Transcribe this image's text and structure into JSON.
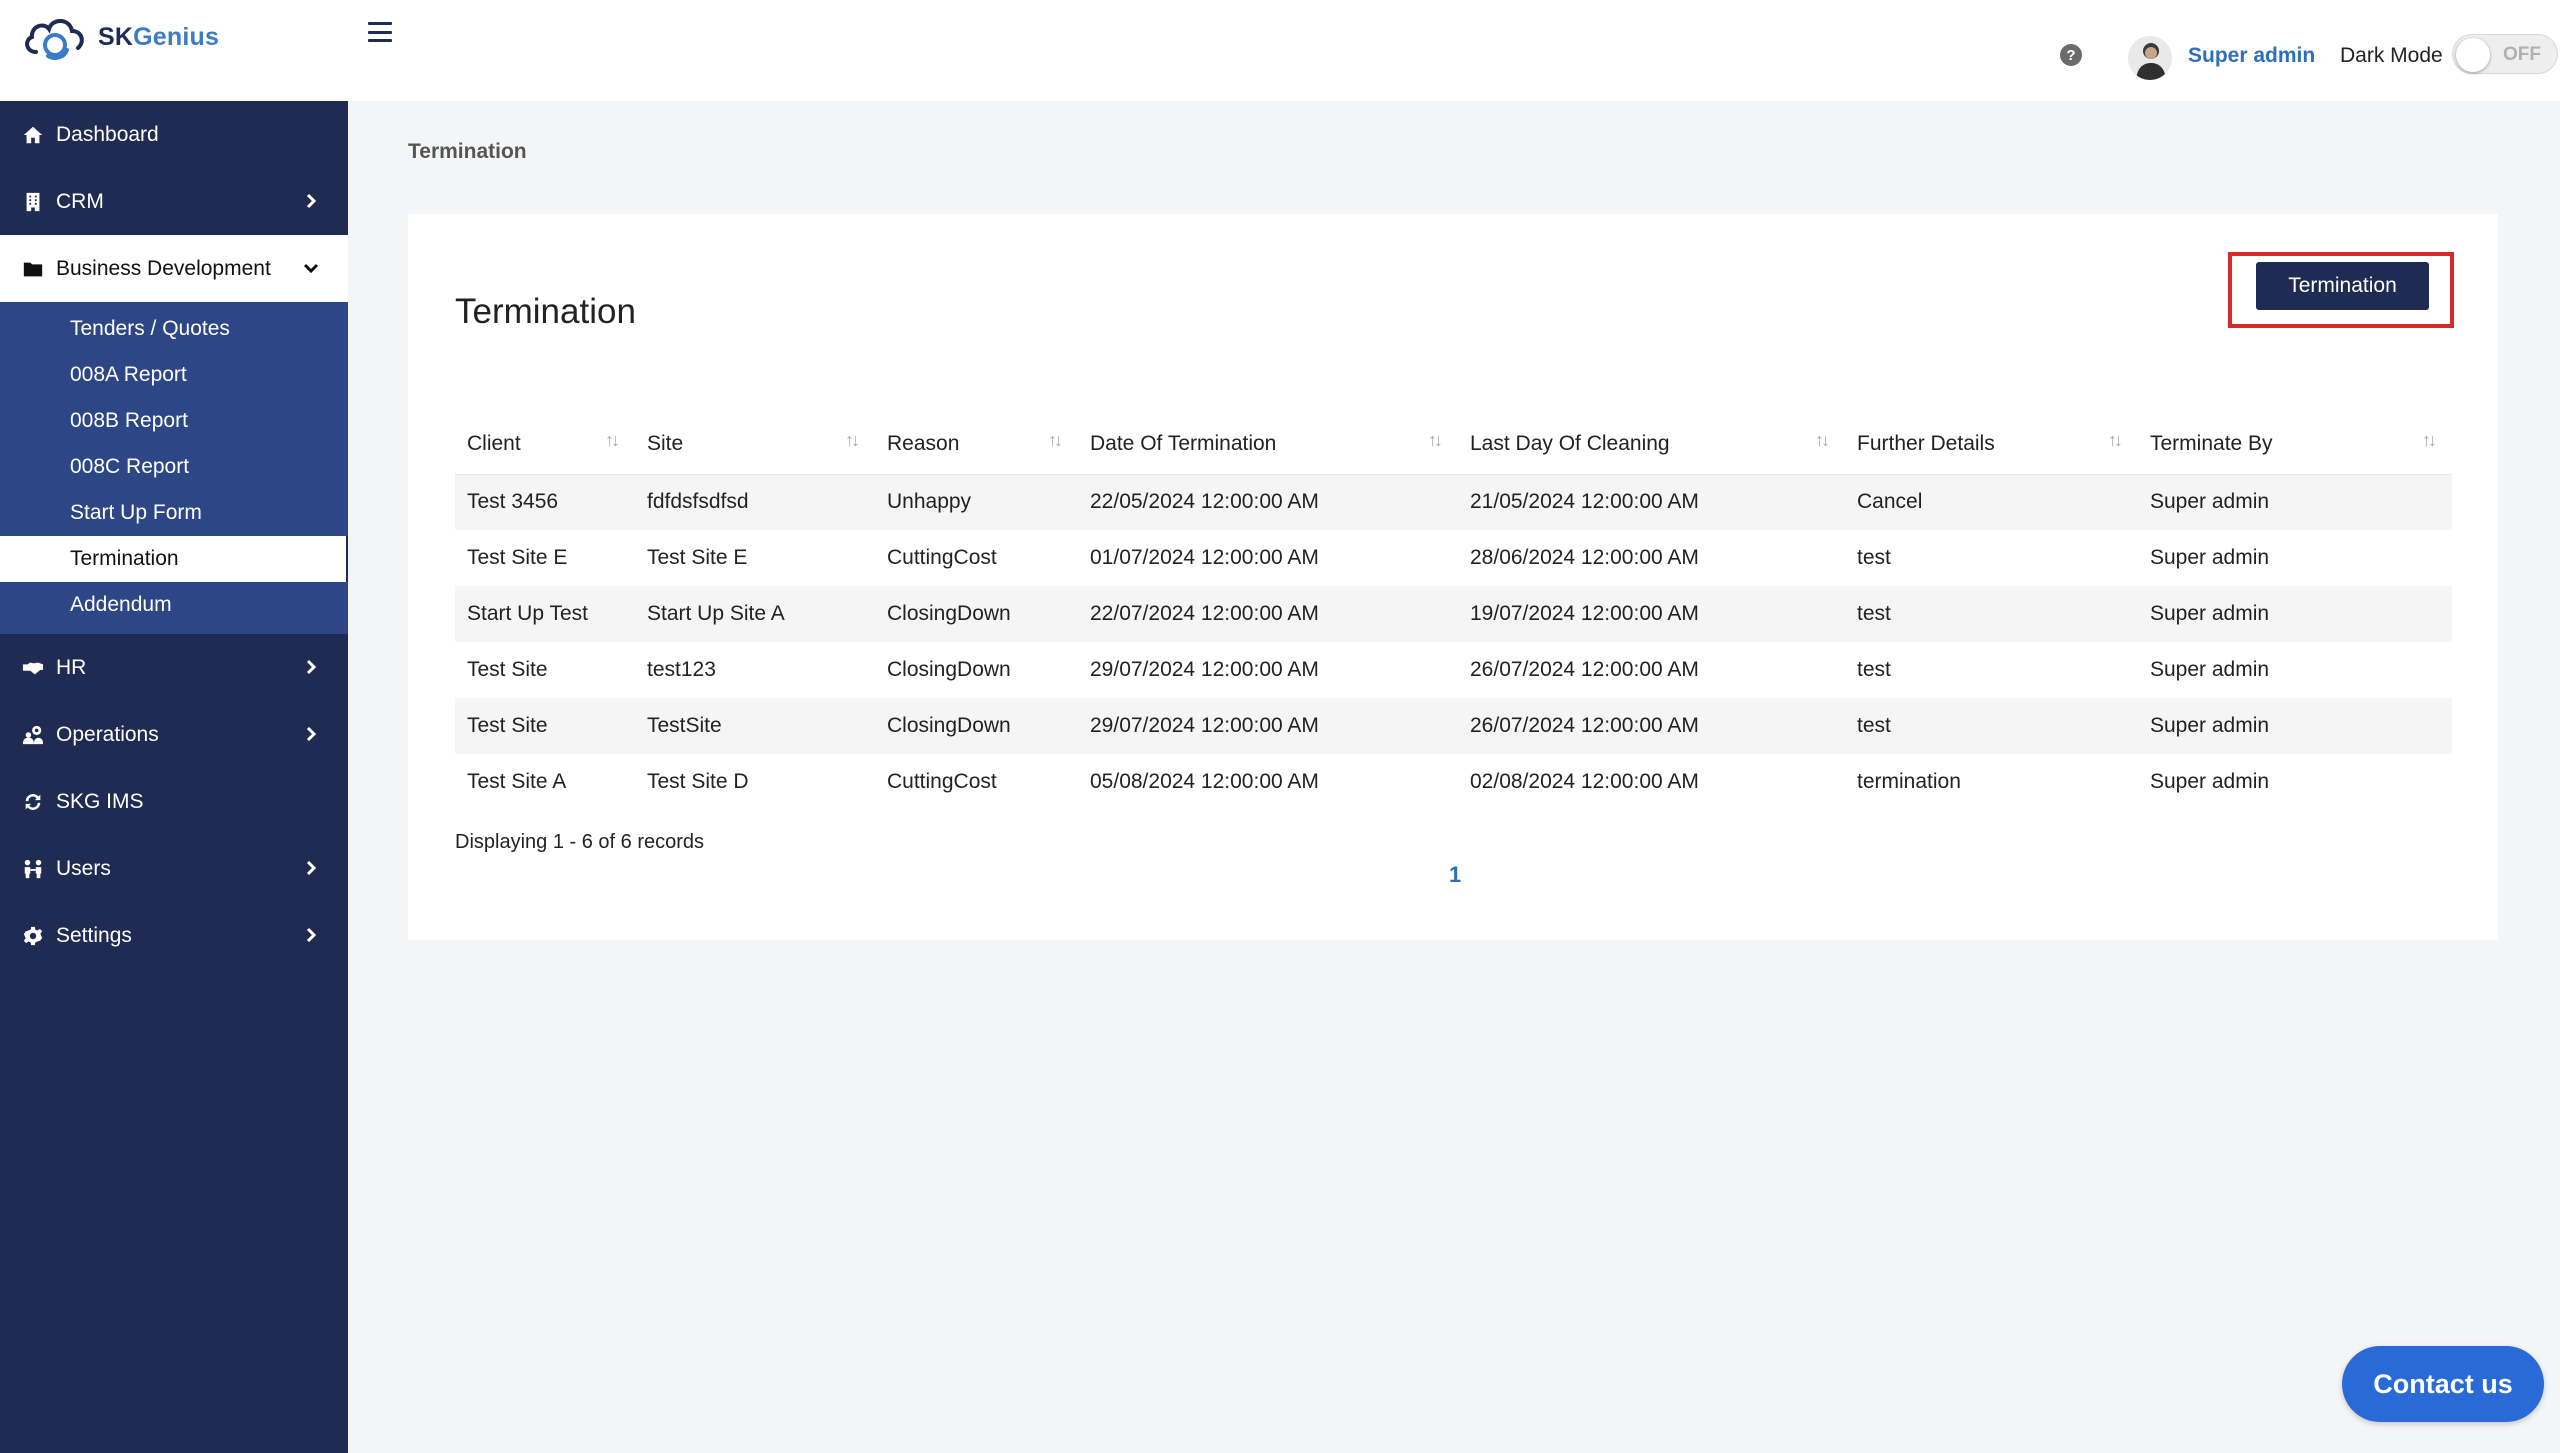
{
  "brand": {
    "name_part1": "SK",
    "name_part2": "Genius"
  },
  "header": {
    "user_name": "Super admin",
    "dark_mode_label": "Dark Mode",
    "dark_mode_state": "OFF",
    "help_icon": "?"
  },
  "sidebar": {
    "items": [
      {
        "label": "Dashboard",
        "icon": "home-icon"
      },
      {
        "label": "CRM",
        "icon": "building-icon"
      },
      {
        "label": "Business Development",
        "icon": "folder-icon"
      },
      {
        "label": "HR",
        "icon": "handshake-icon"
      },
      {
        "label": "Operations",
        "icon": "gear-users-icon"
      },
      {
        "label": "SKG IMS",
        "icon": "sync-icon"
      },
      {
        "label": "Users",
        "icon": "users-icon"
      },
      {
        "label": "Settings",
        "icon": "gear-icon"
      }
    ],
    "submenu": [
      "Tenders / Quotes",
      "008A Report",
      "008B Report",
      "008C Report",
      "Start Up Form",
      "Termination",
      "Addendum"
    ]
  },
  "breadcrumb": "Termination",
  "card": {
    "title": "Termination",
    "button_label": "Termination",
    "table": {
      "columns": [
        "Client",
        "Site",
        "Reason",
        "Date Of Termination",
        "Last Day Of Cleaning",
        "Further Details",
        "Terminate By"
      ],
      "rows": [
        [
          "Test 3456",
          "fdfdsfsdfsd",
          "Unhappy",
          "22/05/2024 12:00:00 AM",
          "21/05/2024 12:00:00 AM",
          "Cancel",
          "Super admin"
        ],
        [
          "Test Site E",
          "Test Site E",
          "CuttingCost",
          "01/07/2024 12:00:00 AM",
          "28/06/2024 12:00:00 AM",
          "test",
          "Super admin"
        ],
        [
          "Start Up Test",
          "Start Up Site A",
          "ClosingDown",
          "22/07/2024 12:00:00 AM",
          "19/07/2024 12:00:00 AM",
          "test",
          "Super admin"
        ],
        [
          "Test Site",
          "test123",
          "ClosingDown",
          "29/07/2024 12:00:00 AM",
          "26/07/2024 12:00:00 AM",
          "test",
          "Super admin"
        ],
        [
          "Test Site",
          "TestSite",
          "ClosingDown",
          "29/07/2024 12:00:00 AM",
          "26/07/2024 12:00:00 AM",
          "test",
          "Super admin"
        ],
        [
          "Test Site A",
          "Test Site D",
          "CuttingCost",
          "05/08/2024 12:00:00 AM",
          "02/08/2024 12:00:00 AM",
          "termination",
          "Super admin"
        ]
      ]
    },
    "records_text": "Displaying 1 - 6 of 6 records",
    "current_page": "1"
  },
  "contact_label": "Contact us",
  "colors": {
    "sidebar_bg": "#1f2b52",
    "submenu_bg": "#2d4786",
    "accent_blue": "#2d6fb8",
    "highlight_red": "#d52b2b",
    "contact_bg": "#2a6ad6"
  }
}
